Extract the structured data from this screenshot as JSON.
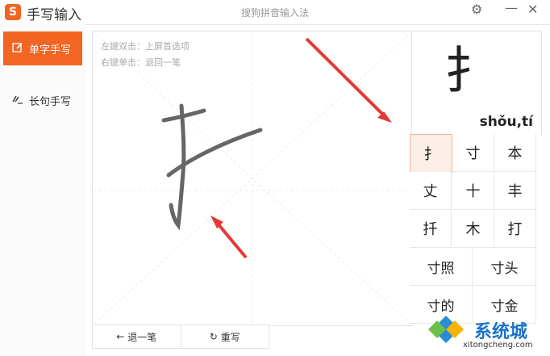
{
  "titlebar": {
    "logo_letter": "S",
    "title": "手写输入",
    "center_title": "搜狗拼音输入法",
    "settings_icon": "gear-icon",
    "minimize_icon": "minimize-icon",
    "close_icon": "close-icon"
  },
  "sidebar": {
    "items": [
      {
        "label": "单字手写",
        "icon": "edit-icon"
      },
      {
        "label": "长句手写",
        "icon": "pen-lines-icon"
      }
    ]
  },
  "canvas": {
    "hint_line1": "左键双击：上屏首选项",
    "hint_line2": "右键单击：退回一笔"
  },
  "bottom": {
    "undo_label": "退一笔",
    "rewrite_label": "重写"
  },
  "preview": {
    "char": "扌",
    "pinyin": "shǒu,tí"
  },
  "candidates": {
    "row1": [
      "扌",
      "寸",
      "本"
    ],
    "row2": [
      "丈",
      "十",
      "丰"
    ],
    "row3": [
      "扦",
      "木",
      "打"
    ],
    "row4": [
      "寸照",
      "寸头"
    ],
    "row5": [
      "寸的",
      "寸金"
    ]
  },
  "watermark": {
    "brand": "系统城",
    "url": "xitongcheng.com"
  },
  "colors": {
    "accent": "#f26522",
    "arrow": "#e53935",
    "stroke": "#666666"
  }
}
